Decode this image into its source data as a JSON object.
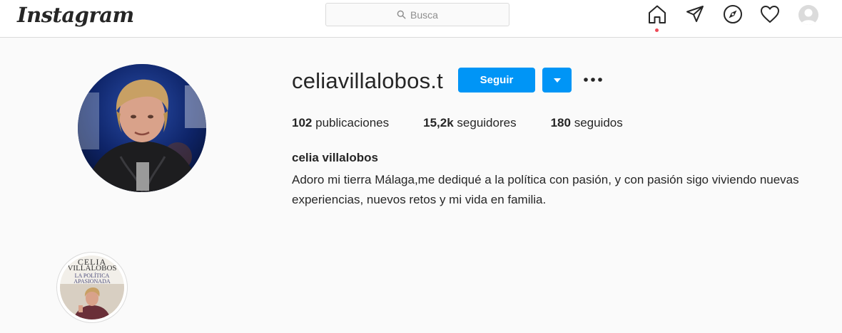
{
  "header": {
    "logo": "Instagram",
    "search_placeholder": "Busca",
    "nav_icons": [
      "home-icon",
      "direct-icon",
      "explore-icon",
      "activity-heart-icon",
      "profile-avatar"
    ]
  },
  "profile": {
    "username": "celiavillalobos.t",
    "follow_label": "Seguir",
    "stats": {
      "posts_count": "102",
      "posts_label": "publicaciones",
      "followers_count": "15,2k",
      "followers_label": "seguidores",
      "following_count": "180",
      "following_label": "seguidos"
    },
    "full_name": "celia villalobos",
    "bio": "Adoro mi tierra Málaga,me dediqué a la política con pasión, y con pasión sigo viviendo nuevas experiencias, nuevos retos y mi vida en familia."
  },
  "highlight": {
    "title_line1": "CELIA",
    "title_line2": "VILLALOBOS",
    "subtitle_line1": "LA POLÍTICA",
    "subtitle_line2": "APASIONADA"
  },
  "colors": {
    "accent": "#0095f6",
    "notification_dot": "#ed4956",
    "background": "#fafafa"
  }
}
